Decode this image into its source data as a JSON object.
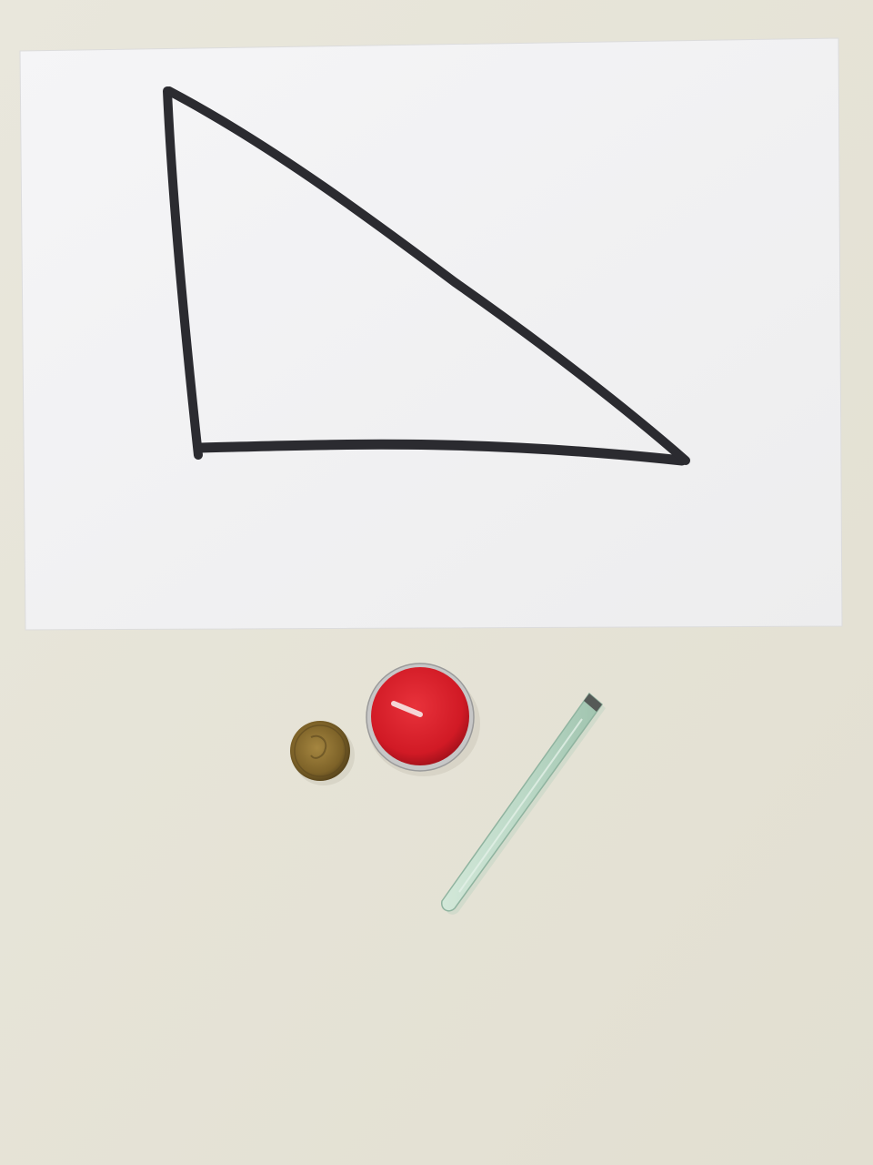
{
  "scene": {
    "background_color": "#e6e3d6",
    "paper_color": "#f3f3f4",
    "marker_color": "#2a2a2e",
    "coin_color": "#8a6d2e",
    "tealight_wax_color": "#d81e2a",
    "tealight_rim_color": "#c9c9c9",
    "tweezers_color": "#bfdccb"
  },
  "objects": [
    {
      "name": "sheet-of-paper"
    },
    {
      "name": "hand-drawn-right-triangle"
    },
    {
      "name": "coin"
    },
    {
      "name": "red-tealight-candle"
    },
    {
      "name": "tweezers"
    }
  ]
}
